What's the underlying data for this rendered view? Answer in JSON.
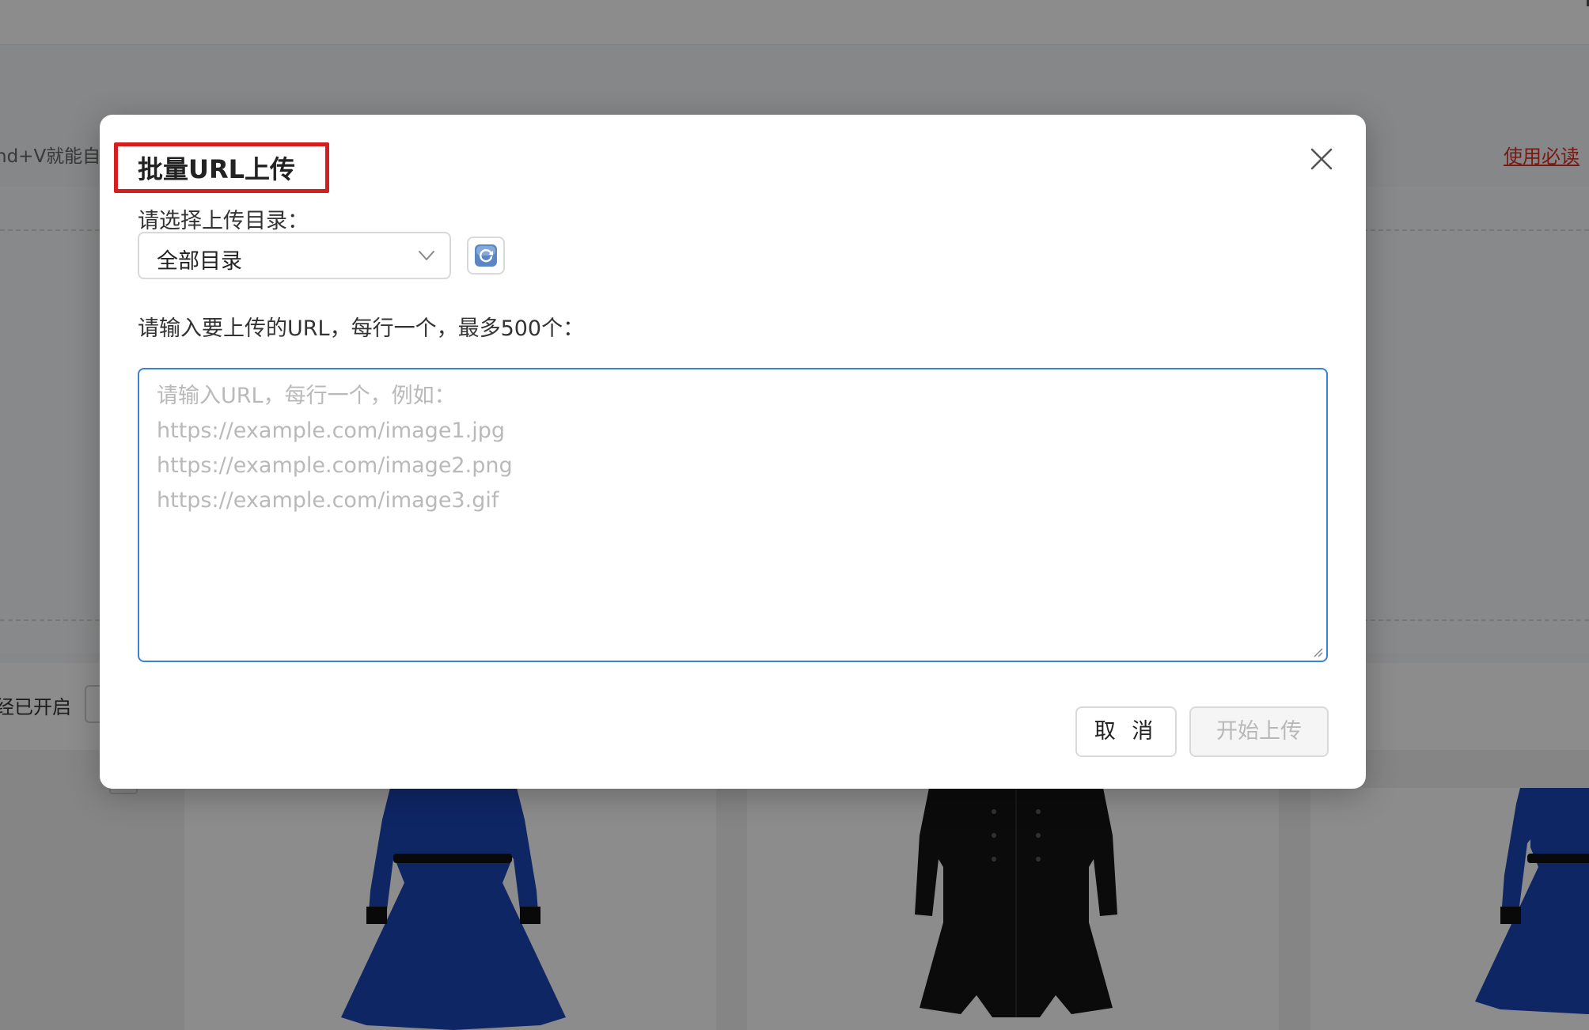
{
  "background": {
    "hint_text": "nd+V就能自动",
    "notice_link": "使用必读",
    "status_text": "经已开启"
  },
  "modal": {
    "title": "批量URL上传",
    "directory_label": "请选择上传目录：",
    "directory_selected": "全部目录",
    "url_label": "请输入要上传的URL，每行一个，最多500个：",
    "placeholder_lines": [
      "请输入URL，每行一个，例如：",
      "https://example.com/image1.jpg",
      "https://example.com/image2.png",
      "https://example.com/image3.gif"
    ],
    "cancel_label": "取 消",
    "start_label": "开始上传"
  },
  "colors": {
    "highlight": "#d3201f",
    "textarea_focus": "#3b82d6",
    "notice_link": "#d93025"
  },
  "icons": [
    "close-icon",
    "chevron-down-icon",
    "refresh-icon",
    "resize-grip-icon"
  ]
}
